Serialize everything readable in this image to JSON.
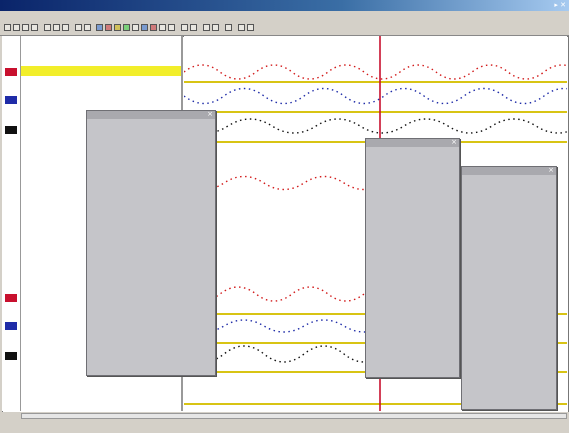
{
  "window": {
    "title": "",
    "controls": "▸ ✕"
  },
  "menu": [],
  "signals": [],
  "panels": {},
  "status": {},
  "colors": {
    "accent_red": "#c8102e",
    "band_yellow": "#d8c414",
    "trace_red": "#d21a1a",
    "trace_blue": "#1f2ca8",
    "trace_black": "#111111",
    "panel_grey": "#c5c5c9",
    "title_blue": "#0a246a"
  }
}
